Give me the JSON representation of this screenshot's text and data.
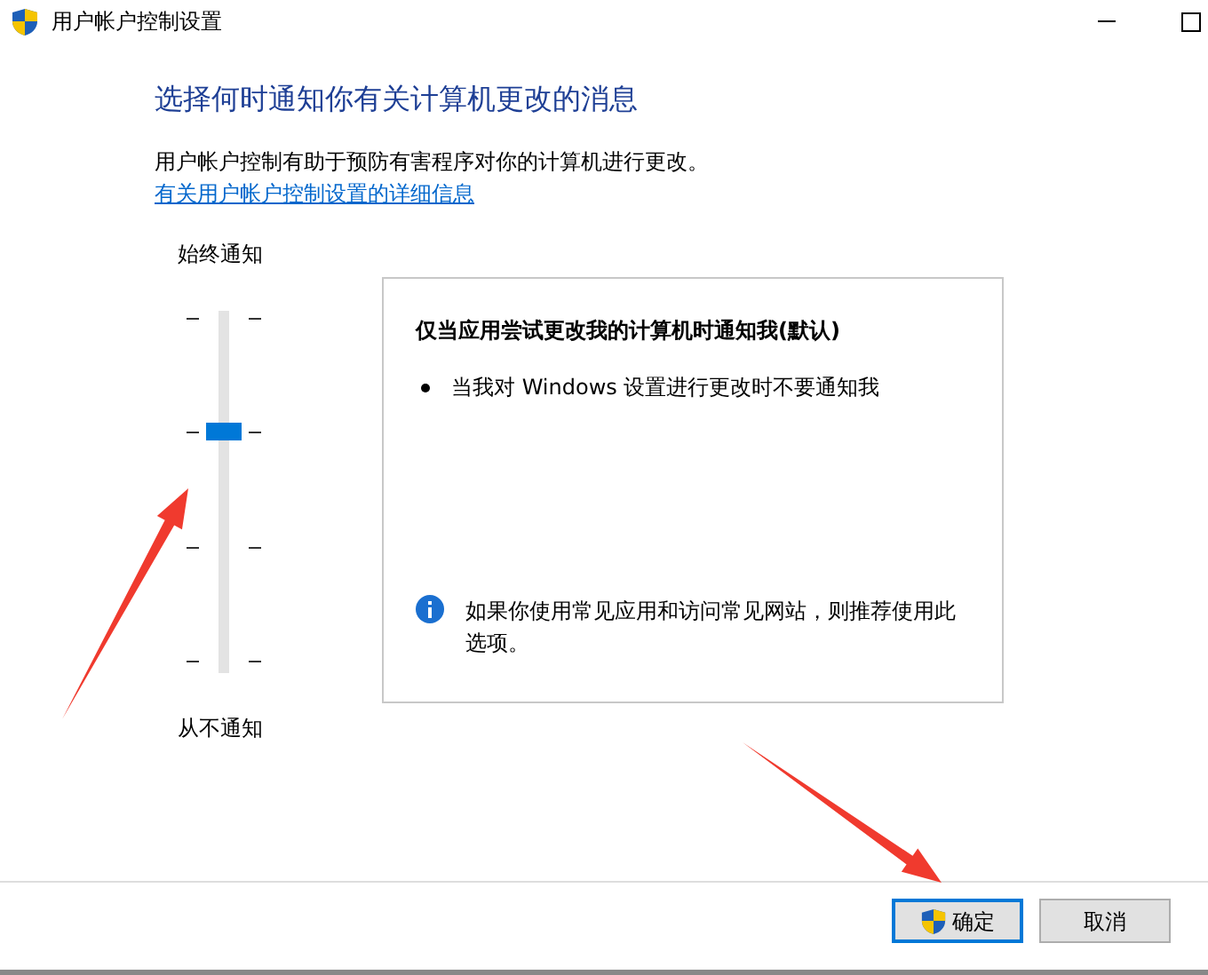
{
  "window": {
    "title": "用户帐户控制设置"
  },
  "heading": "选择何时通知你有关计算机更改的消息",
  "description": "用户帐户控制有助于预防有害程序对你的计算机进行更改。",
  "link": "有关用户帐户控制设置的详细信息",
  "slider": {
    "top_label": "始终通知",
    "bottom_label": "从不通知",
    "level": 0.667
  },
  "info_panel": {
    "title": "仅当应用尝试更改我的计算机时通知我(默认)",
    "bullets": [
      "当我对 Windows 设置进行更改时不要通知我"
    ],
    "note": "如果你使用常见应用和访问常见网站，则推荐使用此选项。"
  },
  "buttons": [
    {
      "label": "确定",
      "kind": "primary",
      "shield": true
    },
    {
      "label": "取消",
      "kind": "normal",
      "shield": false
    }
  ],
  "annotations": [
    {
      "kind": "arrow"
    },
    {
      "kind": "arrow"
    }
  ]
}
